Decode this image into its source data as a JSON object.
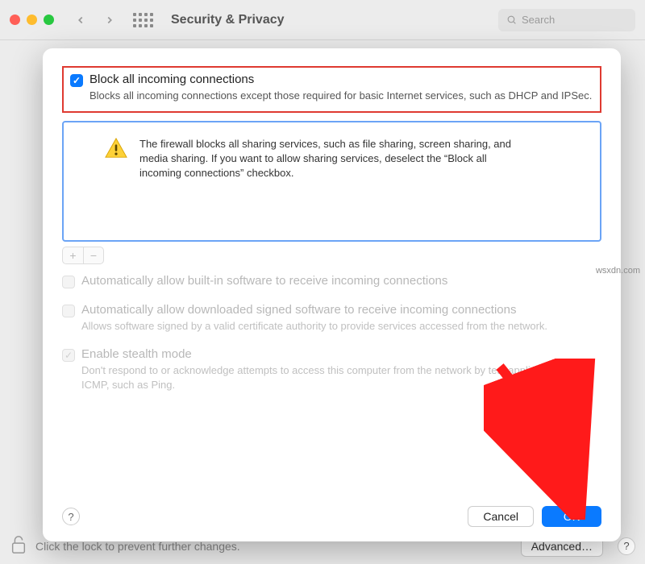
{
  "toolbar": {
    "title": "Security & Privacy",
    "search_placeholder": "Search"
  },
  "block_all": {
    "label": "Block all incoming connections",
    "desc": "Blocks all incoming connections except those required for basic Internet services, such as DHCP and IPSec.",
    "checked": true
  },
  "info": {
    "text": "The firewall blocks all sharing services, such as file sharing, screen sharing, and media sharing. If you want to allow sharing services, deselect the “Block all incoming connections” checkbox."
  },
  "addremove": {
    "add": "+",
    "remove": "−"
  },
  "opt_builtin": {
    "label": "Automatically allow built-in software to receive incoming connections"
  },
  "opt_signed": {
    "label": "Automatically allow downloaded signed software to receive incoming connections",
    "desc": "Allows software signed by a valid certificate authority to provide services accessed from the network."
  },
  "opt_stealth": {
    "label": "Enable stealth mode",
    "desc": "Don't respond to or acknowledge attempts to access this computer from the network by test applications using ICMP, such as Ping."
  },
  "footer": {
    "help": "?",
    "cancel": "Cancel",
    "ok": "OK"
  },
  "background": {
    "lock_text": "Click the lock to prevent further changes.",
    "advanced": "Advanced…",
    "help": "?"
  },
  "watermark": "wsxdn.com"
}
